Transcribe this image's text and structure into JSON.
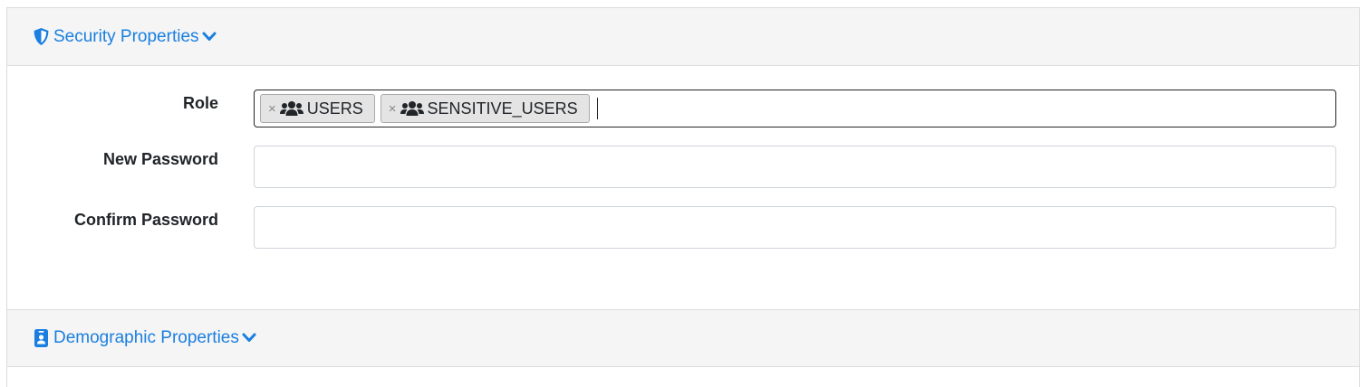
{
  "sections": {
    "security": {
      "title": "Security Properties",
      "icon": "shield-icon",
      "expanded": true
    },
    "demographic": {
      "title": "Demographic Properties",
      "icon": "id-badge-icon",
      "expanded": false
    }
  },
  "form": {
    "role": {
      "label": "Role",
      "chips": [
        {
          "remove": "×",
          "icon": "users-icon",
          "label": "USERS"
        },
        {
          "remove": "×",
          "icon": "users-icon",
          "label": "SENSITIVE_USERS"
        }
      ],
      "input_value": ""
    },
    "new_password": {
      "label": "New Password",
      "value": ""
    },
    "confirm_password": {
      "label": "Confirm Password",
      "value": ""
    }
  },
  "colors": {
    "link": "#1a7fe0",
    "header_bg": "#f5f5f5",
    "chip_bg": "#e4e4e4"
  }
}
